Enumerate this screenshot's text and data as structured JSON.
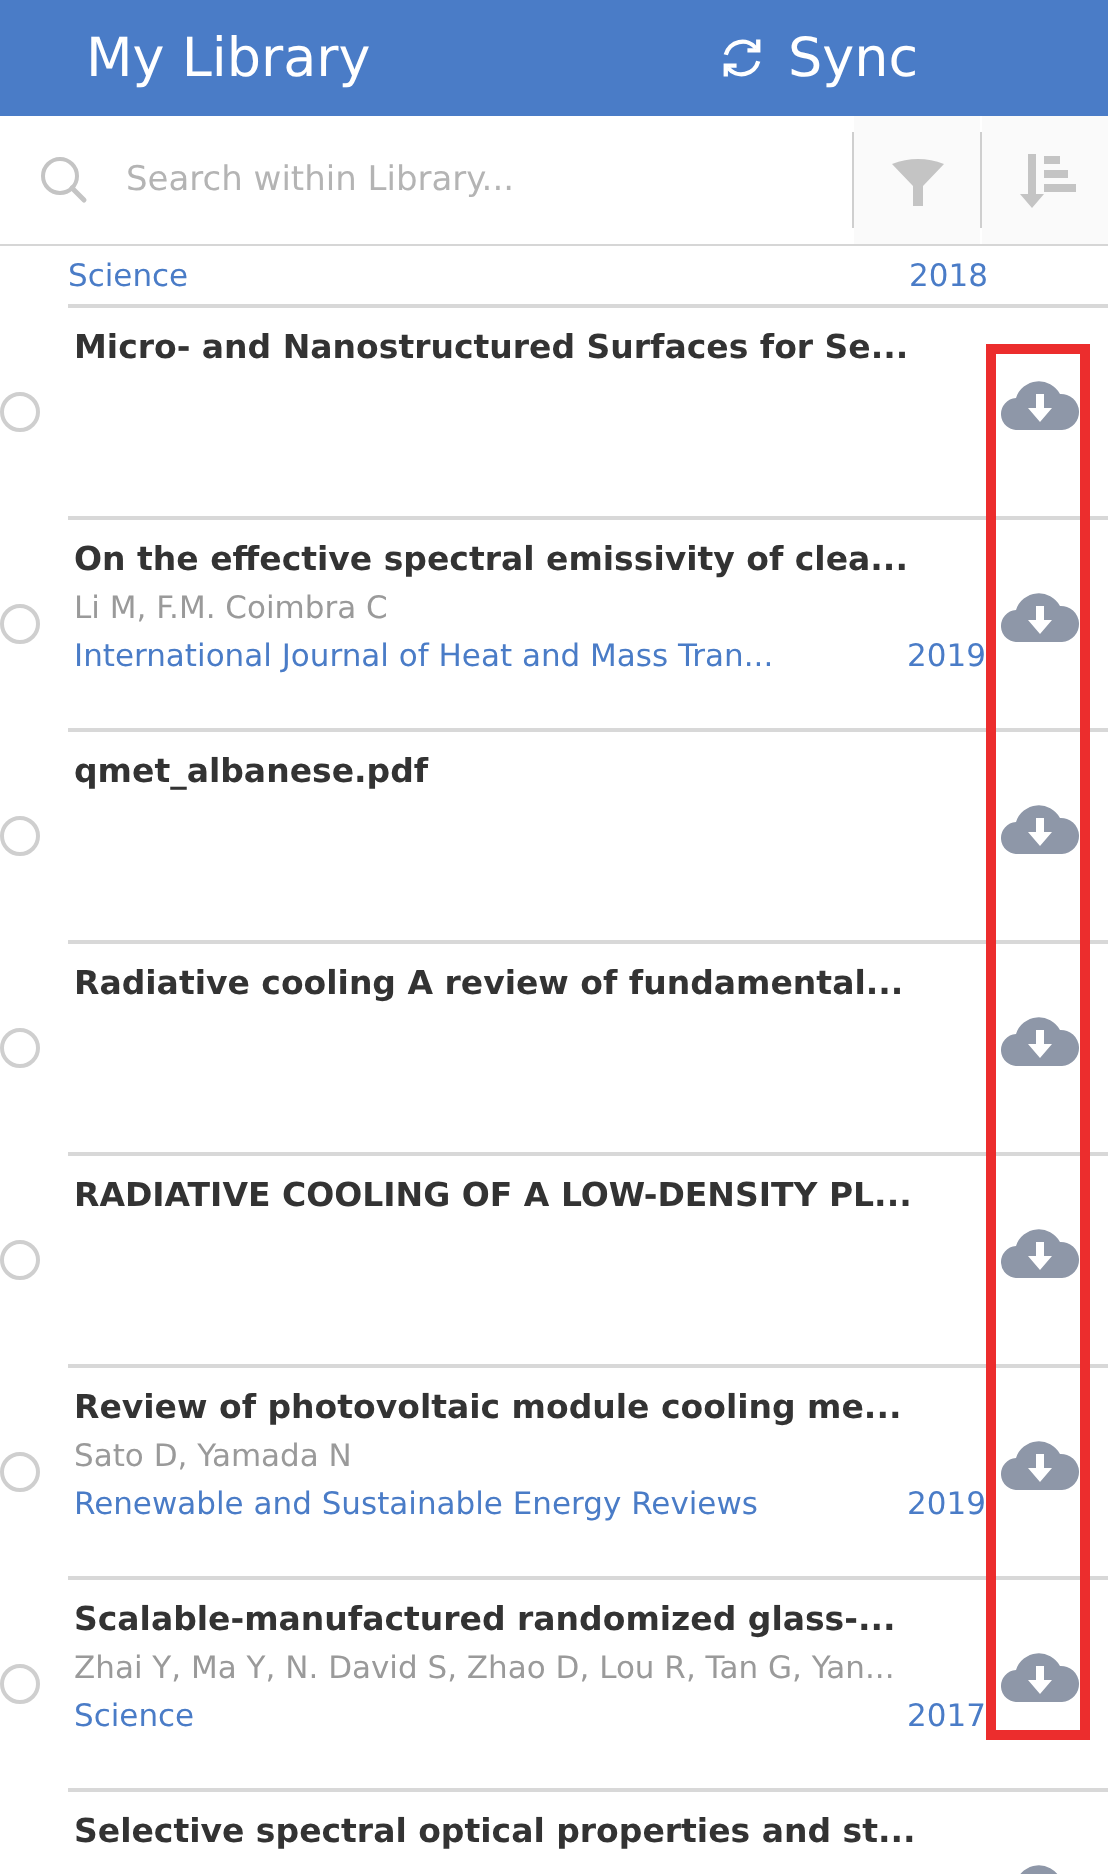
{
  "header": {
    "title": "My Library",
    "sync_label": "Sync"
  },
  "search": {
    "placeholder": "Search within Library..."
  },
  "items": [
    {
      "kind": "partial",
      "journal": "Science",
      "year": "2018"
    },
    {
      "kind": "full",
      "title": "Micro- and Nanostructured Surfaces for Se...",
      "selected": false
    },
    {
      "kind": "full",
      "title": "On the effective spectral emissivity of clea...",
      "authors": "Li M, F.M. Coimbra C",
      "journal": "International Journal of Heat and Mass Tran...",
      "year": "2019",
      "selected": false
    },
    {
      "kind": "full",
      "title": "qmet_albanese.pdf",
      "selected": false
    },
    {
      "kind": "full",
      "title": "Radiative cooling A review of fundamental...",
      "selected": false
    },
    {
      "kind": "full",
      "title": "RADIATIVE COOLING OF A LOW-DENSITY PL...",
      "selected": false
    },
    {
      "kind": "full",
      "title": "Review of photovoltaic module cooling me...",
      "authors": "Sato D, Yamada N",
      "journal": "Renewable and Sustainable Energy Reviews",
      "year": "2019",
      "selected": false
    },
    {
      "kind": "full",
      "title": "Scalable-manufactured randomized glass-...",
      "authors": "Zhai Y, Ma Y, N. David S, Zhao D, Lou R, Tan G, Yan...",
      "journal": "Science",
      "year": "2017",
      "selected": false
    },
    {
      "kind": "full",
      "title": "Selective spectral optical properties and st..."
    }
  ],
  "highlight": true
}
